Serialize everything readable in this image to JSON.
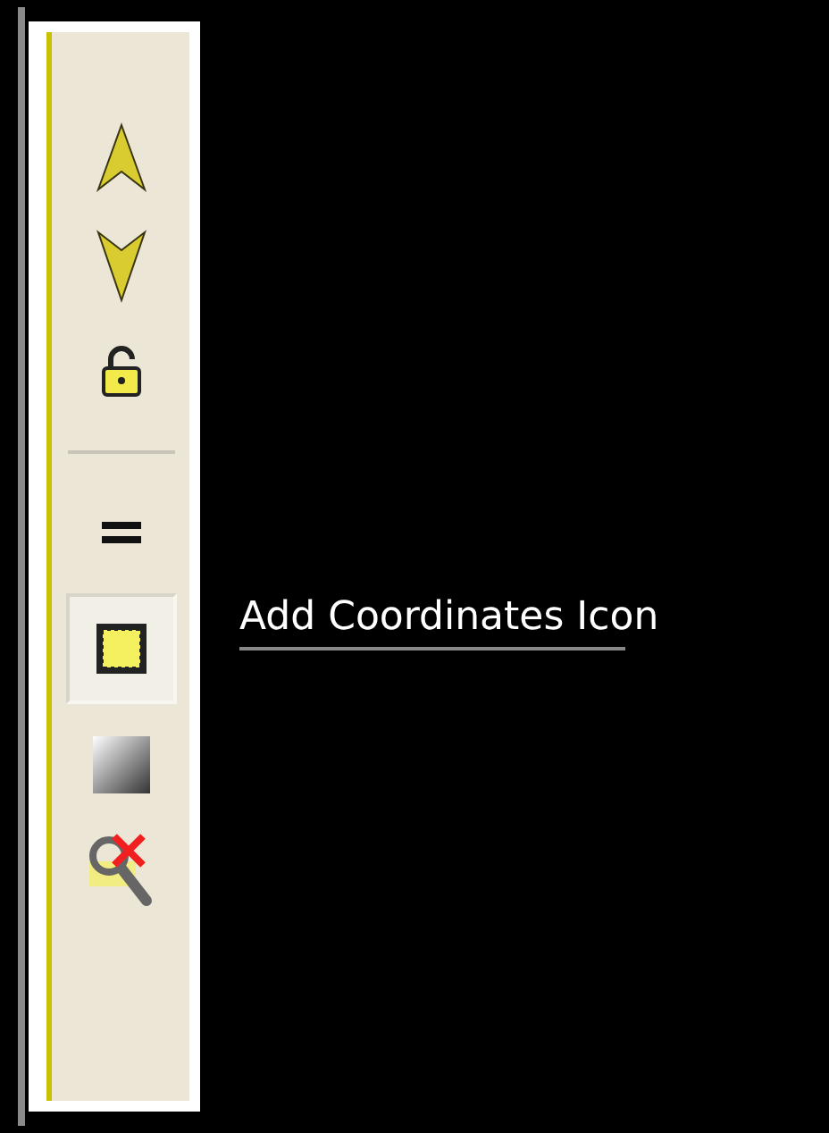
{
  "toolbar": {
    "groups": [
      [
        {
          "selected": false
        },
        {
          "selected": false
        },
        {
          "selected": false
        }
      ],
      [
        {
          "selected": false
        },
        {
          "selected": true
        },
        {
          "selected": false
        },
        {
          "selected": false
        }
      ]
    ]
  },
  "callout": {
    "label": "Add Coordinates Icon"
  }
}
